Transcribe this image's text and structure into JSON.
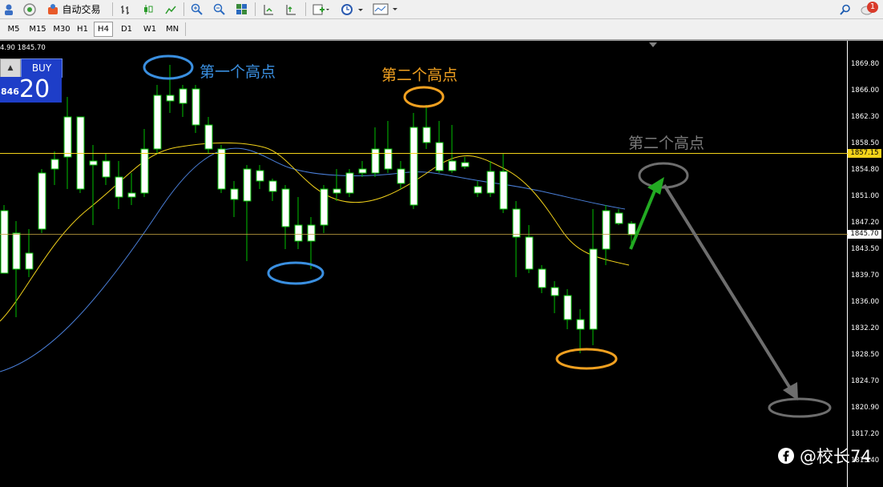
{
  "toolbar": {
    "autotrade_label": "自动交易",
    "notification_count": "1"
  },
  "timeframes": [
    "M5",
    "M15",
    "M30",
    "H1",
    "H4",
    "D1",
    "W1",
    "MN"
  ],
  "active_timeframe": "H4",
  "chart": {
    "ohlc_text": "4.90 1845.70",
    "buy_label": "BUY",
    "price_small": "846",
    "price_big": "20",
    "current_price": "1845.70",
    "marked_level": "1857.15",
    "price_axis": [
      "1869.80",
      "1866.00",
      "1862.30",
      "1858.50",
      "1854.80",
      "1851.00",
      "1847.20",
      "1843.50",
      "1839.70",
      "1836.00",
      "1832.20",
      "1828.50",
      "1824.70",
      "1820.90",
      "1817.20",
      "1813.40"
    ],
    "colors": {
      "bull": "#ffffff",
      "bear": "#000000",
      "wick": "#00c000",
      "ma_fast": "#f2d21a",
      "ma_slow": "#4a7fd9",
      "annot_blue": "#3a8fe0",
      "annot_orange": "#f0a020",
      "annot_gray": "#7a7a7a",
      "arrow_green": "#22aa22"
    }
  },
  "annotations": {
    "label_1": "第一个高点",
    "label_2": "第二个高点",
    "label_3": "第二个高点"
  },
  "watermark": "@校长74"
}
